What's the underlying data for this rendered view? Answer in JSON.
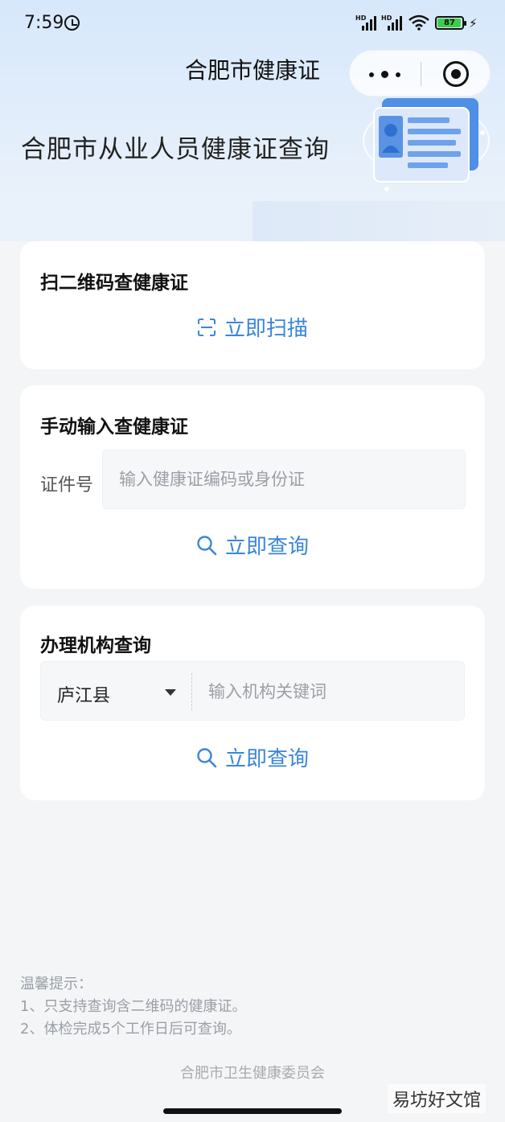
{
  "status_bar": {
    "time": "7:59",
    "battery": "87",
    "signal_label": "HD"
  },
  "nav": {
    "title": "合肥市健康证"
  },
  "hero": {
    "title": "合肥市从业人员健康证查询"
  },
  "scan_card": {
    "title": "扫二维码查健康证",
    "action_label": "立即扫描"
  },
  "manual_card": {
    "title": "手动输入查健康证",
    "field_label": "证件号",
    "input_placeholder": "输入健康证编码或身份证",
    "action_label": "立即查询"
  },
  "org_card": {
    "title": "办理机构查询",
    "selected_district": "庐江县",
    "input_placeholder": "输入机构关键词",
    "action_label": "立即查询"
  },
  "tips": {
    "heading": "温馨提示：",
    "line1": "1、只支持查询含二维码的健康证。",
    "line2": "2、体检完成5个工作日后可查询。"
  },
  "footer": {
    "text": "合肥市卫生健康委员会"
  },
  "watermark": {
    "text": "易坊好文馆"
  },
  "colors": {
    "accent": "#3a86d8",
    "background": "#f4f5f7",
    "header_gradient_top": "#d6e8fb"
  }
}
